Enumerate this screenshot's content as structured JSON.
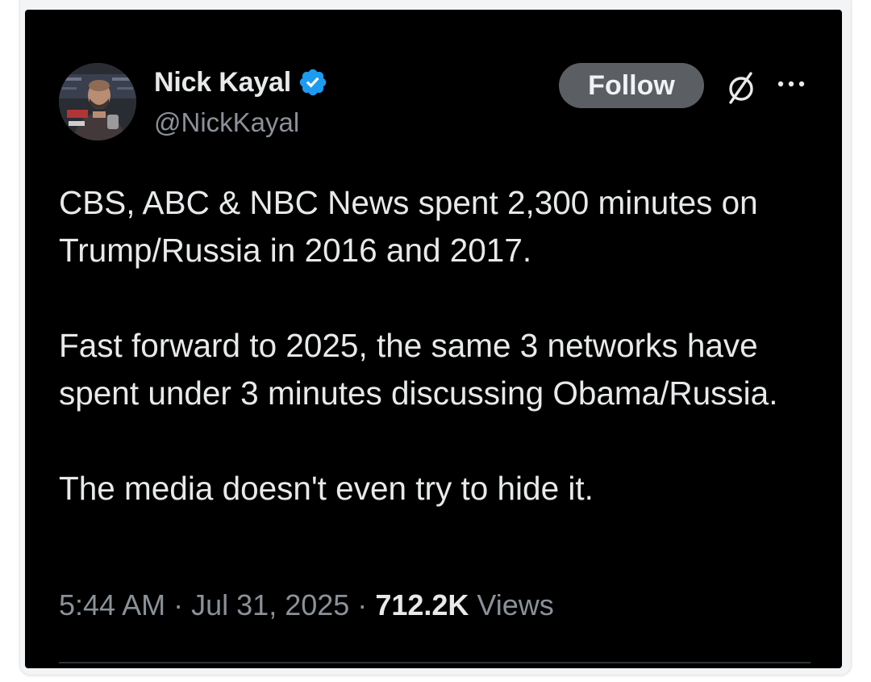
{
  "author": {
    "display_name": "Nick Kayal",
    "handle": "@NickKayal",
    "verified": true,
    "avatar_icon": "profile-photo"
  },
  "actions": {
    "follow_label": "Follow",
    "grok_icon": "grok-icon",
    "more_icon": "more-horizontal-icon"
  },
  "tweet": {
    "paragraphs": [
      "CBS, ABC & NBC News spent 2,300 minutes on Trump/Russia in 2016 and 2017.",
      "Fast forward to 2025, the same 3 networks have spent under 3 minutes discussing Obama/Russia.",
      "The media doesn't even try to hide it."
    ],
    "time": "5:44 AM",
    "separator": "·",
    "date": "Jul 31, 2025",
    "views_count": "712.2K",
    "views_label": "Views"
  },
  "colors": {
    "background": "#000000",
    "text": "#e7e9ea",
    "secondary_text": "#8b9198",
    "follow_button": "#5b5f63",
    "verified_badge": "#1d9bf0"
  }
}
